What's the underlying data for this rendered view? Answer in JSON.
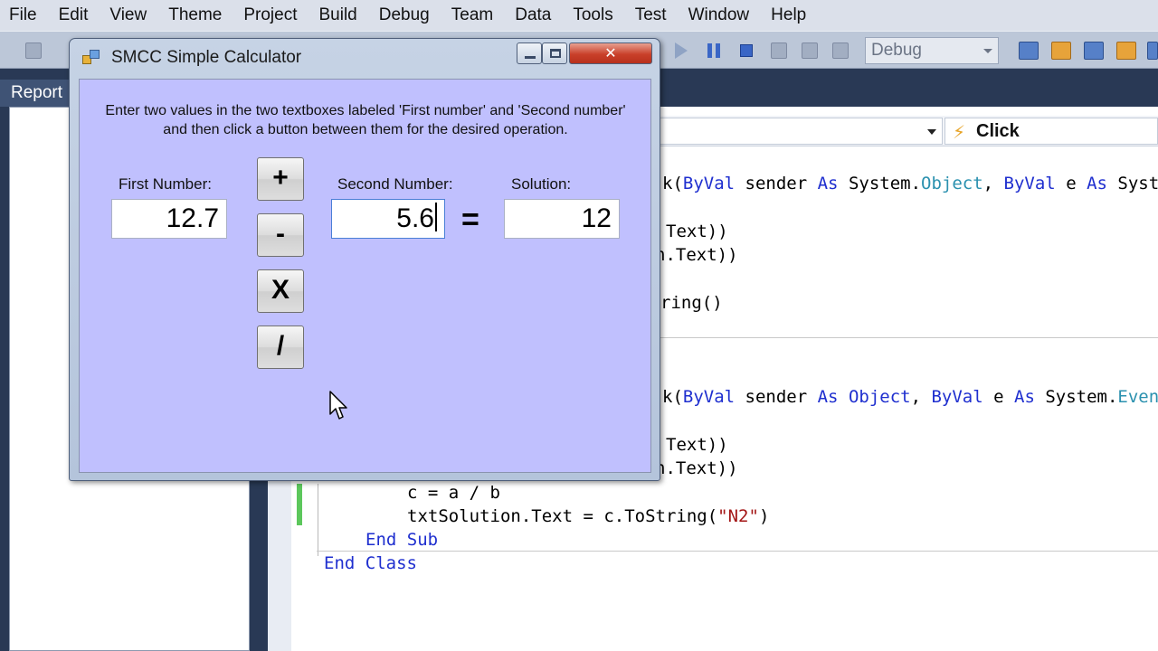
{
  "ide": {
    "menu": [
      "File",
      "Edit",
      "View",
      "Theme",
      "Project",
      "Build",
      "Debug",
      "Team",
      "Data",
      "Tools",
      "Test",
      "Window",
      "Help"
    ],
    "config": "Debug",
    "report_tab": "Report",
    "nav_event": "Click",
    "code": {
      "l1a": "k(",
      "l1b": "ByVal",
      "l1c": " sender ",
      "l1d": "As",
      "l1e": " System.",
      "l1f": "Object",
      "l1g": ", ",
      "l1h": "ByVal",
      "l1i": " e ",
      "l1j": "As",
      "l1k": " Syste",
      "l2": "Text))",
      "l3": "n.Text))",
      "l4": "ring()",
      "l5a": "k(",
      "l5b": "ByVal",
      "l5c": " sender ",
      "l5d": "As",
      "l5e": " ",
      "l5f": "Object",
      "l5g": ", ",
      "l5h": "ByVal",
      "l5i": " e ",
      "l5j": "As",
      "l5k": " System.",
      "l5l": "Event",
      "l6": "Text))",
      "l7": "n.Text))",
      "l8": "c = a / b",
      "l9a": "txtSolution.Text = c.ToString(",
      "l9b": "\"N2\"",
      "l9c": ")",
      "l10a": "End",
      "l10b": " ",
      "l10c": "Sub",
      "l11a": "End",
      "l11b": " ",
      "l11c": "Class"
    }
  },
  "calculator": {
    "title": "SMCC Simple Calculator",
    "close_glyph": "✕",
    "instructions": "Enter two values in the two textboxes labeled 'First number' and 'Second number' and then click a button between them for the desired operation.",
    "first_label": "First Number:",
    "first_value": "12.7",
    "second_label": "Second Number:",
    "second_value": "5.6",
    "solution_label": "Solution:",
    "solution_value": "12",
    "equals": "=",
    "buttons": {
      "add": "+",
      "subtract": "-",
      "multiply": "X",
      "divide": "/"
    }
  }
}
